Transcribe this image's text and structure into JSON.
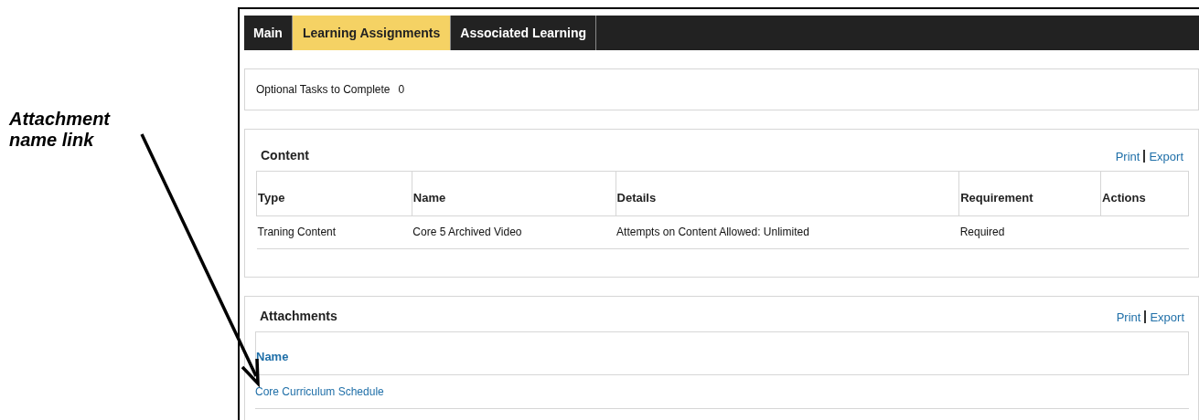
{
  "annotation": {
    "text": "Attachment name link"
  },
  "tabs": [
    {
      "label": "Main",
      "selected": false
    },
    {
      "label": "Learning Assignments",
      "selected": true
    },
    {
      "label": "Associated Learning",
      "selected": false
    }
  ],
  "summary": {
    "label": "Optional Tasks to Complete",
    "value": "0"
  },
  "content": {
    "title": "Content",
    "actions": [
      "Print",
      "Export"
    ],
    "columns": [
      "Type",
      "Name",
      "Details",
      "Requirement",
      "Actions"
    ],
    "rows": [
      [
        "Traning Content",
        "Core 5 Archived Video",
        "Attempts on Content Allowed: Unlimited",
        "Required",
        ""
      ]
    ]
  },
  "attachments": {
    "title": "Attachments",
    "actions": [
      "Print",
      "Export"
    ],
    "column": "Name",
    "rows": [
      "Core Curriculum Schedule"
    ]
  }
}
